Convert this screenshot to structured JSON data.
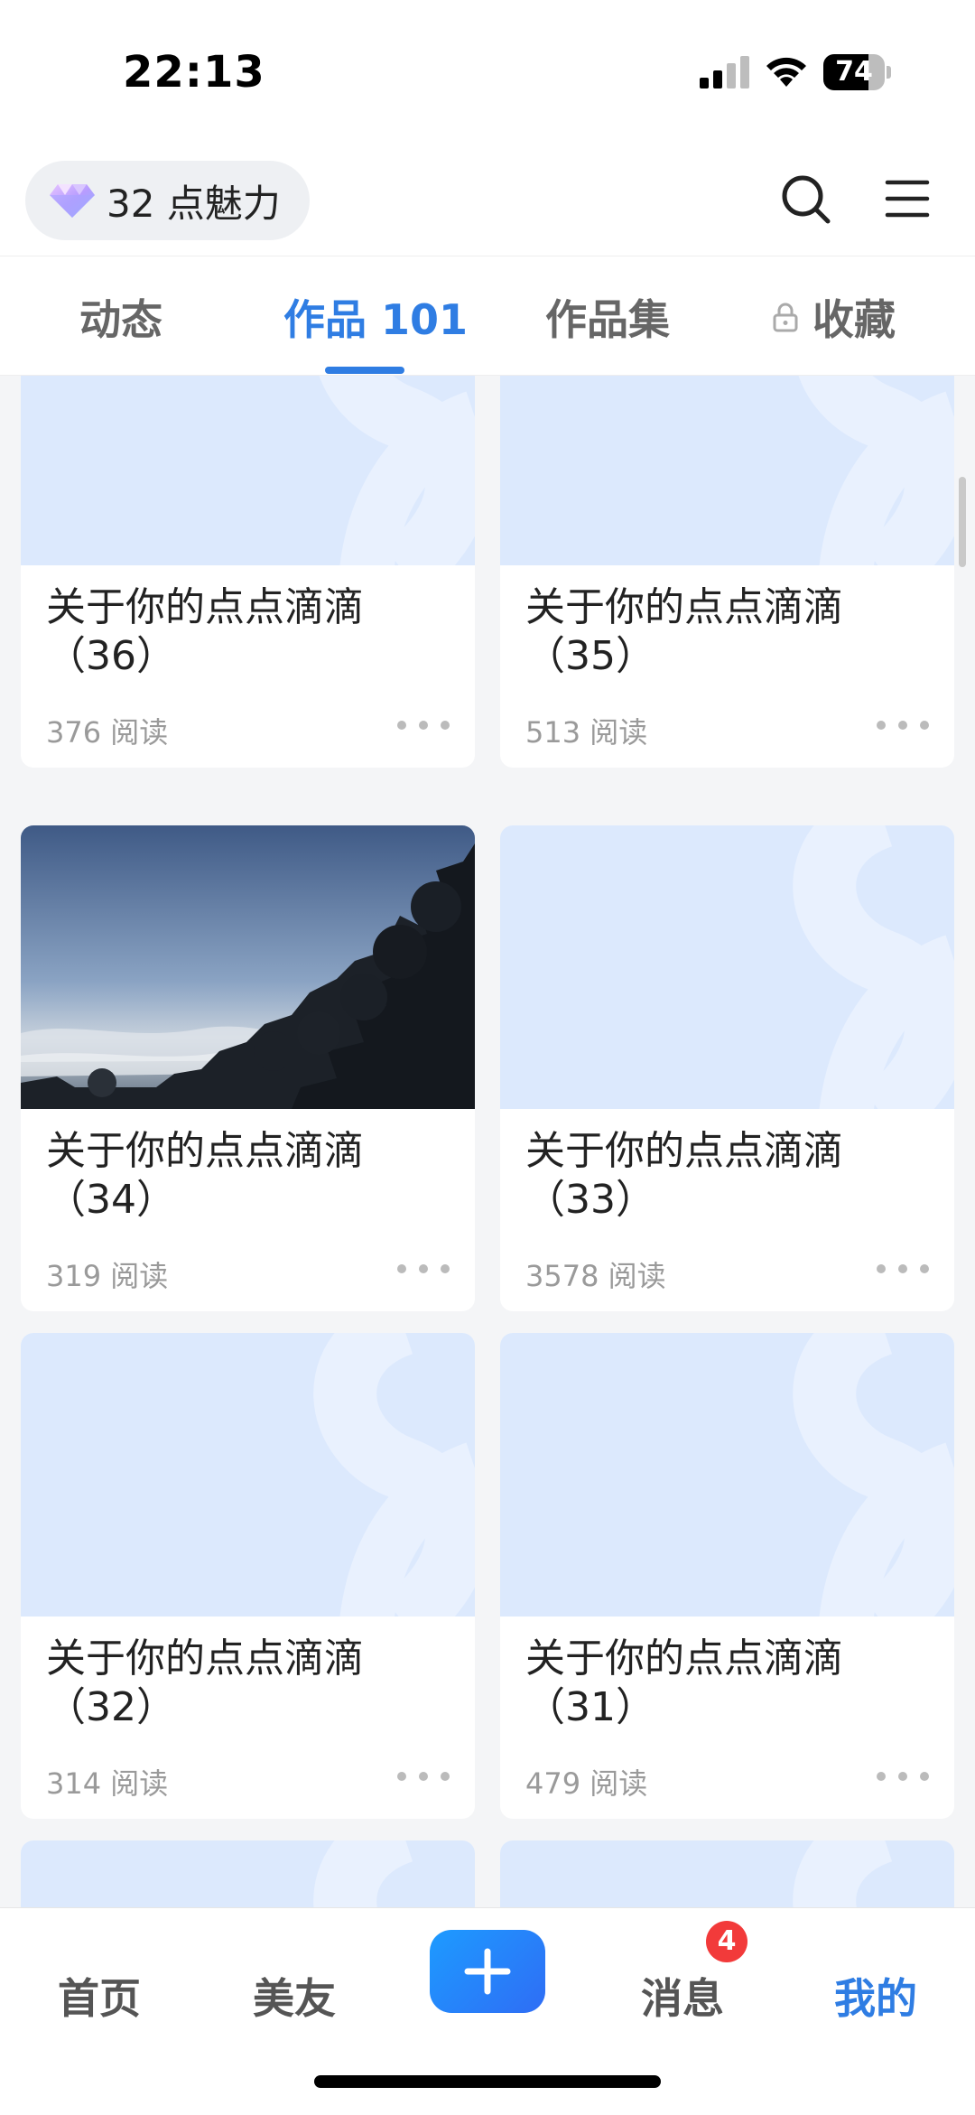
{
  "status_bar": {
    "time": "22:13",
    "battery": "74"
  },
  "top_bar": {
    "charm_label": "32 点魅力",
    "icons": [
      "gem-icon",
      "search-icon",
      "menu-icon"
    ]
  },
  "tabs": [
    {
      "label": "动态",
      "active": false
    },
    {
      "label": "作品 101",
      "active": true
    },
    {
      "label": "作品集",
      "active": false
    },
    {
      "label": "收藏",
      "active": false,
      "icon": "lock-icon"
    }
  ],
  "cards": [
    {
      "title": "关于你的点点滴滴（36）",
      "reads": "376 阅读",
      "thumb": "placeholder"
    },
    {
      "title": "关于你的点点滴滴（35）",
      "reads": "513 阅读",
      "thumb": "placeholder"
    },
    {
      "title": "关于你的点点滴滴（34）",
      "reads": "319 阅读",
      "thumb": "photo"
    },
    {
      "title": "关于你的点点滴滴（33）",
      "reads": "3578 阅读",
      "thumb": "placeholder"
    },
    {
      "title": "关于你的点点滴滴（32）",
      "reads": "314 阅读",
      "thumb": "placeholder"
    },
    {
      "title": "关于你的点点滴滴（31）",
      "reads": "479 阅读",
      "thumb": "placeholder"
    }
  ],
  "bottom_nav": {
    "home": "首页",
    "friends": "美友",
    "messages": "消息",
    "messages_badge": "4",
    "me": "我的",
    "active": "me"
  },
  "colors": {
    "accent": "#2f7de3",
    "thumb_placeholder": "#dce9fd",
    "badge": "#f23a3a"
  }
}
